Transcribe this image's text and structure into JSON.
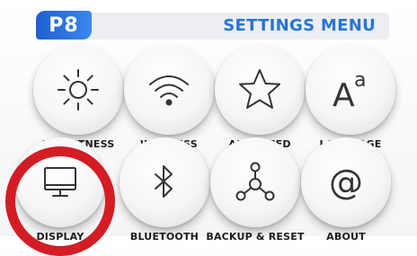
{
  "header": {
    "badge": "P8",
    "title": "SETTINGS MENU"
  },
  "menu": {
    "items": [
      {
        "label": "BRIGHTNESS",
        "icon": "brightness-icon"
      },
      {
        "label": "WIRELESS",
        "icon": "wifi-icon"
      },
      {
        "label": "ADVANCED",
        "icon": "star-icon"
      },
      {
        "label": "LANGUAGE",
        "icon": "language-icon"
      },
      {
        "label": "DISPLAY",
        "icon": "monitor-icon"
      },
      {
        "label": "BLUETOOTH",
        "icon": "bluetooth-icon"
      },
      {
        "label": "BACKUP & RESET",
        "icon": "backup-network-icon"
      },
      {
        "label": "ABOUT",
        "icon": "at-sign-icon"
      }
    ],
    "language_icon_text": {
      "main": "A",
      "sup": "a"
    },
    "about_icon_text": "@"
  },
  "colors": {
    "accent": "#2774d6",
    "badge": "#2a6fe0",
    "highlight": "#d41c24",
    "icon": "#333333"
  }
}
